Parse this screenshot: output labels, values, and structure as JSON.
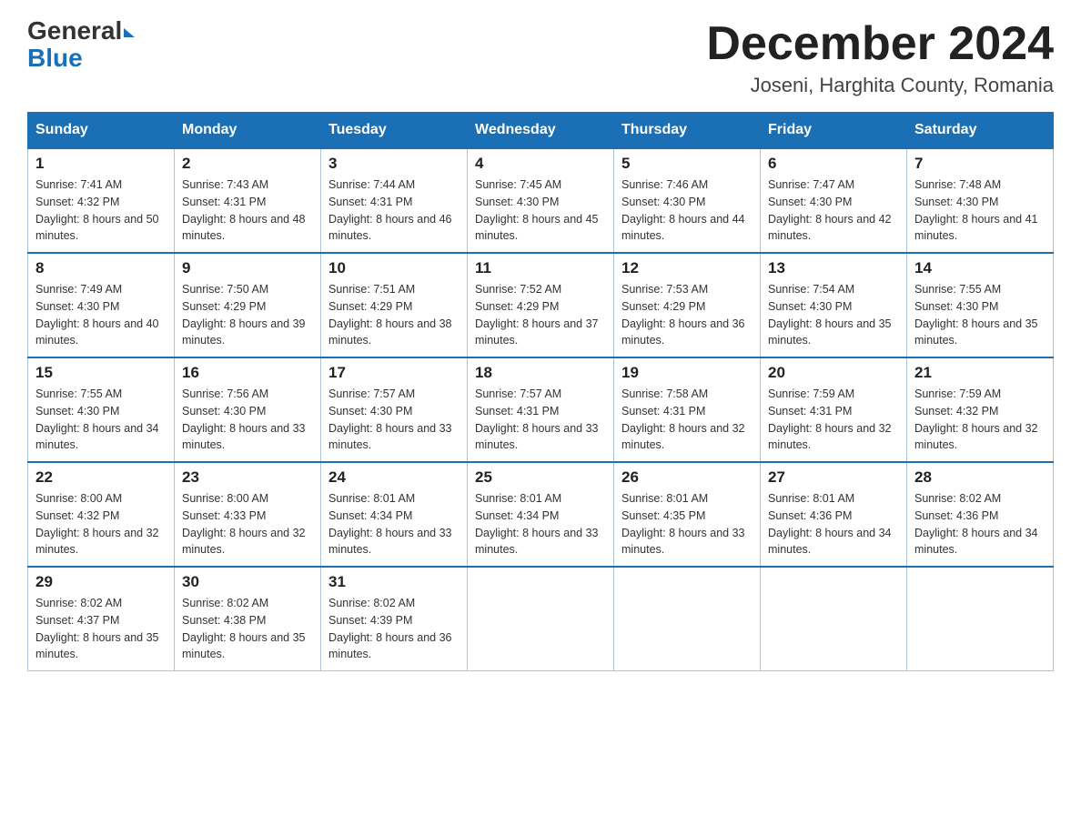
{
  "header": {
    "logo_general": "General",
    "logo_blue": "Blue",
    "main_title": "December 2024",
    "subtitle": "Joseni, Harghita County, Romania"
  },
  "days_of_week": [
    "Sunday",
    "Monday",
    "Tuesday",
    "Wednesday",
    "Thursday",
    "Friday",
    "Saturday"
  ],
  "weeks": [
    [
      {
        "day": "1",
        "sunrise": "7:41 AM",
        "sunset": "4:32 PM",
        "daylight": "8 hours and 50 minutes."
      },
      {
        "day": "2",
        "sunrise": "7:43 AM",
        "sunset": "4:31 PM",
        "daylight": "8 hours and 48 minutes."
      },
      {
        "day": "3",
        "sunrise": "7:44 AM",
        "sunset": "4:31 PM",
        "daylight": "8 hours and 46 minutes."
      },
      {
        "day": "4",
        "sunrise": "7:45 AM",
        "sunset": "4:30 PM",
        "daylight": "8 hours and 45 minutes."
      },
      {
        "day": "5",
        "sunrise": "7:46 AM",
        "sunset": "4:30 PM",
        "daylight": "8 hours and 44 minutes."
      },
      {
        "day": "6",
        "sunrise": "7:47 AM",
        "sunset": "4:30 PM",
        "daylight": "8 hours and 42 minutes."
      },
      {
        "day": "7",
        "sunrise": "7:48 AM",
        "sunset": "4:30 PM",
        "daylight": "8 hours and 41 minutes."
      }
    ],
    [
      {
        "day": "8",
        "sunrise": "7:49 AM",
        "sunset": "4:30 PM",
        "daylight": "8 hours and 40 minutes."
      },
      {
        "day": "9",
        "sunrise": "7:50 AM",
        "sunset": "4:29 PM",
        "daylight": "8 hours and 39 minutes."
      },
      {
        "day": "10",
        "sunrise": "7:51 AM",
        "sunset": "4:29 PM",
        "daylight": "8 hours and 38 minutes."
      },
      {
        "day": "11",
        "sunrise": "7:52 AM",
        "sunset": "4:29 PM",
        "daylight": "8 hours and 37 minutes."
      },
      {
        "day": "12",
        "sunrise": "7:53 AM",
        "sunset": "4:29 PM",
        "daylight": "8 hours and 36 minutes."
      },
      {
        "day": "13",
        "sunrise": "7:54 AM",
        "sunset": "4:30 PM",
        "daylight": "8 hours and 35 minutes."
      },
      {
        "day": "14",
        "sunrise": "7:55 AM",
        "sunset": "4:30 PM",
        "daylight": "8 hours and 35 minutes."
      }
    ],
    [
      {
        "day": "15",
        "sunrise": "7:55 AM",
        "sunset": "4:30 PM",
        "daylight": "8 hours and 34 minutes."
      },
      {
        "day": "16",
        "sunrise": "7:56 AM",
        "sunset": "4:30 PM",
        "daylight": "8 hours and 33 minutes."
      },
      {
        "day": "17",
        "sunrise": "7:57 AM",
        "sunset": "4:30 PM",
        "daylight": "8 hours and 33 minutes."
      },
      {
        "day": "18",
        "sunrise": "7:57 AM",
        "sunset": "4:31 PM",
        "daylight": "8 hours and 33 minutes."
      },
      {
        "day": "19",
        "sunrise": "7:58 AM",
        "sunset": "4:31 PM",
        "daylight": "8 hours and 32 minutes."
      },
      {
        "day": "20",
        "sunrise": "7:59 AM",
        "sunset": "4:31 PM",
        "daylight": "8 hours and 32 minutes."
      },
      {
        "day": "21",
        "sunrise": "7:59 AM",
        "sunset": "4:32 PM",
        "daylight": "8 hours and 32 minutes."
      }
    ],
    [
      {
        "day": "22",
        "sunrise": "8:00 AM",
        "sunset": "4:32 PM",
        "daylight": "8 hours and 32 minutes."
      },
      {
        "day": "23",
        "sunrise": "8:00 AM",
        "sunset": "4:33 PM",
        "daylight": "8 hours and 32 minutes."
      },
      {
        "day": "24",
        "sunrise": "8:01 AM",
        "sunset": "4:34 PM",
        "daylight": "8 hours and 33 minutes."
      },
      {
        "day": "25",
        "sunrise": "8:01 AM",
        "sunset": "4:34 PM",
        "daylight": "8 hours and 33 minutes."
      },
      {
        "day": "26",
        "sunrise": "8:01 AM",
        "sunset": "4:35 PM",
        "daylight": "8 hours and 33 minutes."
      },
      {
        "day": "27",
        "sunrise": "8:01 AM",
        "sunset": "4:36 PM",
        "daylight": "8 hours and 34 minutes."
      },
      {
        "day": "28",
        "sunrise": "8:02 AM",
        "sunset": "4:36 PM",
        "daylight": "8 hours and 34 minutes."
      }
    ],
    [
      {
        "day": "29",
        "sunrise": "8:02 AM",
        "sunset": "4:37 PM",
        "daylight": "8 hours and 35 minutes."
      },
      {
        "day": "30",
        "sunrise": "8:02 AM",
        "sunset": "4:38 PM",
        "daylight": "8 hours and 35 minutes."
      },
      {
        "day": "31",
        "sunrise": "8:02 AM",
        "sunset": "4:39 PM",
        "daylight": "8 hours and 36 minutes."
      },
      null,
      null,
      null,
      null
    ]
  ]
}
